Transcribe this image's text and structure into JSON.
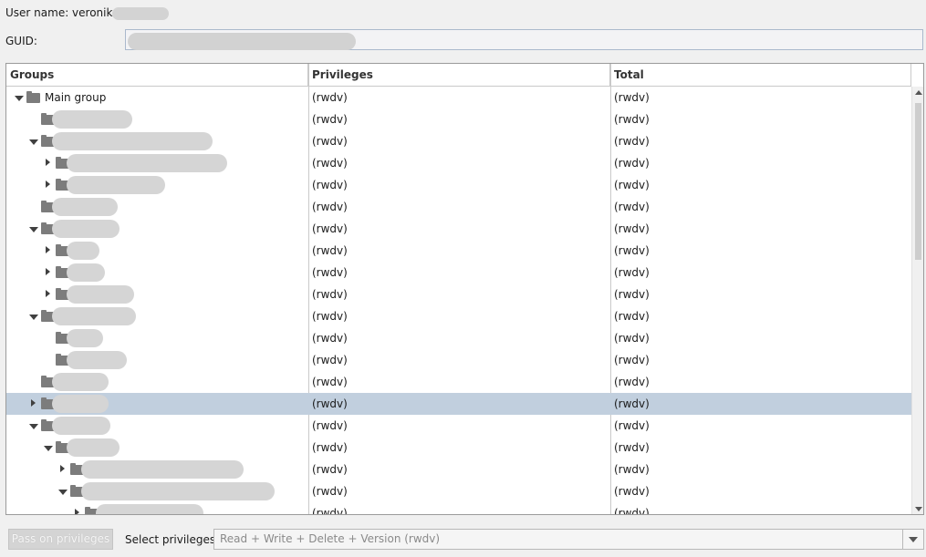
{
  "user": {
    "label": "User name: veronika"
  },
  "guid": {
    "label": "GUID:"
  },
  "table": {
    "columns": [
      "Groups",
      "Privileges",
      "Total"
    ],
    "rows": [
      {
        "indent": 0,
        "expander": "down",
        "name": "Main group",
        "redact_w": 0,
        "priv": "(rwdv)",
        "total": "(rwdv)"
      },
      {
        "indent": 1,
        "expander": "none",
        "name": "",
        "redact_w": 88,
        "priv": "(rwdv)",
        "total": "(rwdv)"
      },
      {
        "indent": 1,
        "expander": "down",
        "name": "",
        "redact_w": 176,
        "priv": "(rwdv)",
        "total": "(rwdv)"
      },
      {
        "indent": 2,
        "expander": "right",
        "name": "",
        "redact_w": 176,
        "priv": "(rwdv)",
        "total": "(rwdv)"
      },
      {
        "indent": 2,
        "expander": "right",
        "name": "",
        "redact_w": 108,
        "priv": "(rwdv)",
        "total": "(rwdv)"
      },
      {
        "indent": 1,
        "expander": "none",
        "name": "",
        "redact_w": 72,
        "priv": "(rwdv)",
        "total": "(rwdv)"
      },
      {
        "indent": 1,
        "expander": "down",
        "name": "",
        "redact_w": 74,
        "priv": "(rwdv)",
        "total": "(rwdv)"
      },
      {
        "indent": 2,
        "expander": "right",
        "name": "",
        "redact_w": 36,
        "priv": "(rwdv)",
        "total": "(rwdv)"
      },
      {
        "indent": 2,
        "expander": "right",
        "name": "",
        "redact_w": 42,
        "priv": "(rwdv)",
        "total": "(rwdv)"
      },
      {
        "indent": 2,
        "expander": "right",
        "name": "",
        "redact_w": 74,
        "priv": "(rwdv)",
        "total": "(rwdv)"
      },
      {
        "indent": 1,
        "expander": "down",
        "name": "",
        "redact_w": 92,
        "priv": "(rwdv)",
        "total": "(rwdv)"
      },
      {
        "indent": 2,
        "expander": "none",
        "name": "",
        "redact_w": 40,
        "priv": "(rwdv)",
        "total": "(rwdv)"
      },
      {
        "indent": 2,
        "expander": "none",
        "name": "",
        "redact_w": 66,
        "priv": "(rwdv)",
        "total": "(rwdv)"
      },
      {
        "indent": 1,
        "expander": "none",
        "name": "",
        "redact_w": 62,
        "priv": "(rwdv)",
        "total": "(rwdv)"
      },
      {
        "indent": 1,
        "expander": "right",
        "name": "",
        "redact_w": 62,
        "priv": "(rwdv)",
        "total": "(rwdv)",
        "selected": true
      },
      {
        "indent": 1,
        "expander": "down",
        "name": "",
        "redact_w": 64,
        "priv": "(rwdv)",
        "total": "(rwdv)"
      },
      {
        "indent": 2,
        "expander": "down",
        "name": "",
        "redact_w": 58,
        "priv": "(rwdv)",
        "total": "(rwdv)"
      },
      {
        "indent": 3,
        "expander": "right",
        "name": "",
        "redact_w": 178,
        "priv": "(rwdv)",
        "total": "(rwdv)"
      },
      {
        "indent": 3,
        "expander": "down",
        "name": "",
        "redact_w": 212,
        "priv": "(rwdv)",
        "total": "(rwdv)"
      },
      {
        "indent": 4,
        "expander": "right",
        "name": "",
        "redact_w": 118,
        "priv": "(rwdv)",
        "total": "(rwdv)"
      }
    ]
  },
  "footer": {
    "pass_button": "Pass on privileges",
    "select_label": "Select privileges:",
    "select_value": "Read + Write + Delete + Version (rwdv)"
  },
  "icons": {
    "folder": "folder-icon",
    "expand": "triangle-right-icon",
    "collapse": "triangle-down-icon",
    "dropdown": "chevron-down-icon"
  }
}
